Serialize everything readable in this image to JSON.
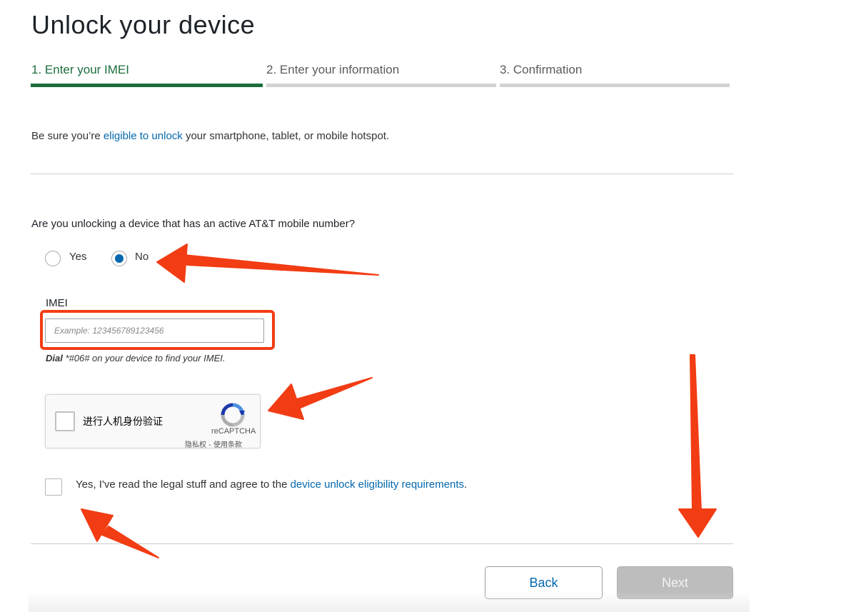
{
  "page": {
    "title": "Unlock your device"
  },
  "steps": [
    {
      "label": "1. Enter your IMEI",
      "active": true
    },
    {
      "label": "2. Enter your information",
      "active": false
    },
    {
      "label": "3. Confirmation",
      "active": false
    }
  ],
  "intro": {
    "before": "Be sure you’re ",
    "link": "eligible to unlock",
    "after": " your smartphone, tablet, or mobile hotspot."
  },
  "question": {
    "text": "Are you unlocking a device that has an active AT&T mobile number?",
    "options": [
      {
        "label": "Yes",
        "selected": false
      },
      {
        "label": "No",
        "selected": true
      }
    ]
  },
  "imei": {
    "label": "IMEI",
    "value": "",
    "placeholder": "Example: 123456789123456",
    "hint_bold": "Dial",
    "hint_rest": " *#06# on your device to find your IMEI."
  },
  "captcha": {
    "label": "进行人机身份验证",
    "brand": "reCAPTCHA",
    "terms": "隐私权 - 使用条款",
    "checked": false
  },
  "agreement": {
    "before": "Yes, I've read the legal stuff and agree to the ",
    "link": "device unlock eligibility requirements",
    "after": ".",
    "checked": false
  },
  "buttons": {
    "back": "Back",
    "next": "Next",
    "next_enabled": false
  },
  "colors": {
    "active_step": "#1b6e3d",
    "link": "#0568ae",
    "annotation": "#f23c14",
    "disabled_button": "#bdbdbd"
  }
}
